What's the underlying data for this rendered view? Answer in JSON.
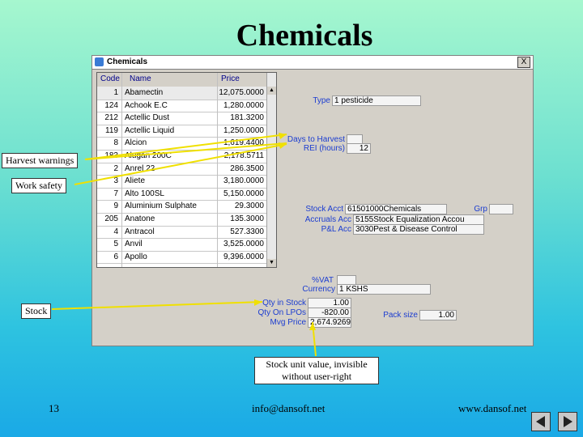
{
  "slide": {
    "title": "Chemicals",
    "footer_left": "13",
    "footer_center": "info@dansoft.net",
    "footer_right": "www.dansof.net"
  },
  "window": {
    "title": "Chemicals",
    "close_label": "X"
  },
  "grid": {
    "columns": [
      "Code",
      "Name",
      "Price"
    ],
    "rows": [
      {
        "code": "1",
        "name": "Abamectin",
        "price": "12,075.0000"
      },
      {
        "code": "124",
        "name": "Achook E.C",
        "price": "1,280.0000"
      },
      {
        "code": "212",
        "name": "Actellic Dust",
        "price": "181.3200"
      },
      {
        "code": "119",
        "name": "Actellic Liquid",
        "price": "1,250.0000"
      },
      {
        "code": "8",
        "name": "Alcion",
        "price": "1,619.4400"
      },
      {
        "code": "183",
        "name": "Alugan 200C",
        "price": "2,178.5711"
      },
      {
        "code": "2",
        "name": "Anrel 22",
        "price": "286.3500"
      },
      {
        "code": "3",
        "name": "Aliete",
        "price": "3,180.0000"
      },
      {
        "code": "7",
        "name": "Alto 100SL",
        "price": "5,150.0000"
      },
      {
        "code": "9",
        "name": "Aluminium Sulphate",
        "price": "29.3000"
      },
      {
        "code": "205",
        "name": "Anatone",
        "price": "135.3000"
      },
      {
        "code": "4",
        "name": "Antracol",
        "price": "527.3300"
      },
      {
        "code": "5",
        "name": "Anvil",
        "price": "3,525.0000"
      },
      {
        "code": "6",
        "name": "Apollo",
        "price": "9,396.0000"
      }
    ]
  },
  "form": {
    "type_label": "Type",
    "type_value": "1 pesticide",
    "days_to_harvest_label": "Days to Harvest",
    "days_to_harvest_value": "",
    "rei_label": "REI (hours)",
    "rei_value": "12",
    "stock_acct_label": "Stock Acct",
    "stock_acct_value": "61501000Chemicals",
    "grp_label": "Grp",
    "accruals_label": "Accruals Acc",
    "accruals_value": "5155Stock Equalization Accou",
    "pl_label": "P&L Acc",
    "pl_value": "3030Pest & Disease Control",
    "vat_label": "%VAT",
    "currency_label": "Currency",
    "currency_value": "1 KSHS",
    "qty_stock_label": "Qty in Stock",
    "qty_stock_value": "1.00",
    "qty_pos_label": "Qty On LPOs",
    "qty_pos_value": "-820.00",
    "mvg_price_label": "Mvg Price",
    "mvg_price_value": "2,674.9269",
    "pack_size_label": "Pack size",
    "pack_size_value": "1.00"
  },
  "callouts": {
    "harvest": "Harvest warnings",
    "work_safety": "Work safety",
    "stock": "Stock",
    "stock_unit": "Stock unit value, invisible without user-right"
  }
}
